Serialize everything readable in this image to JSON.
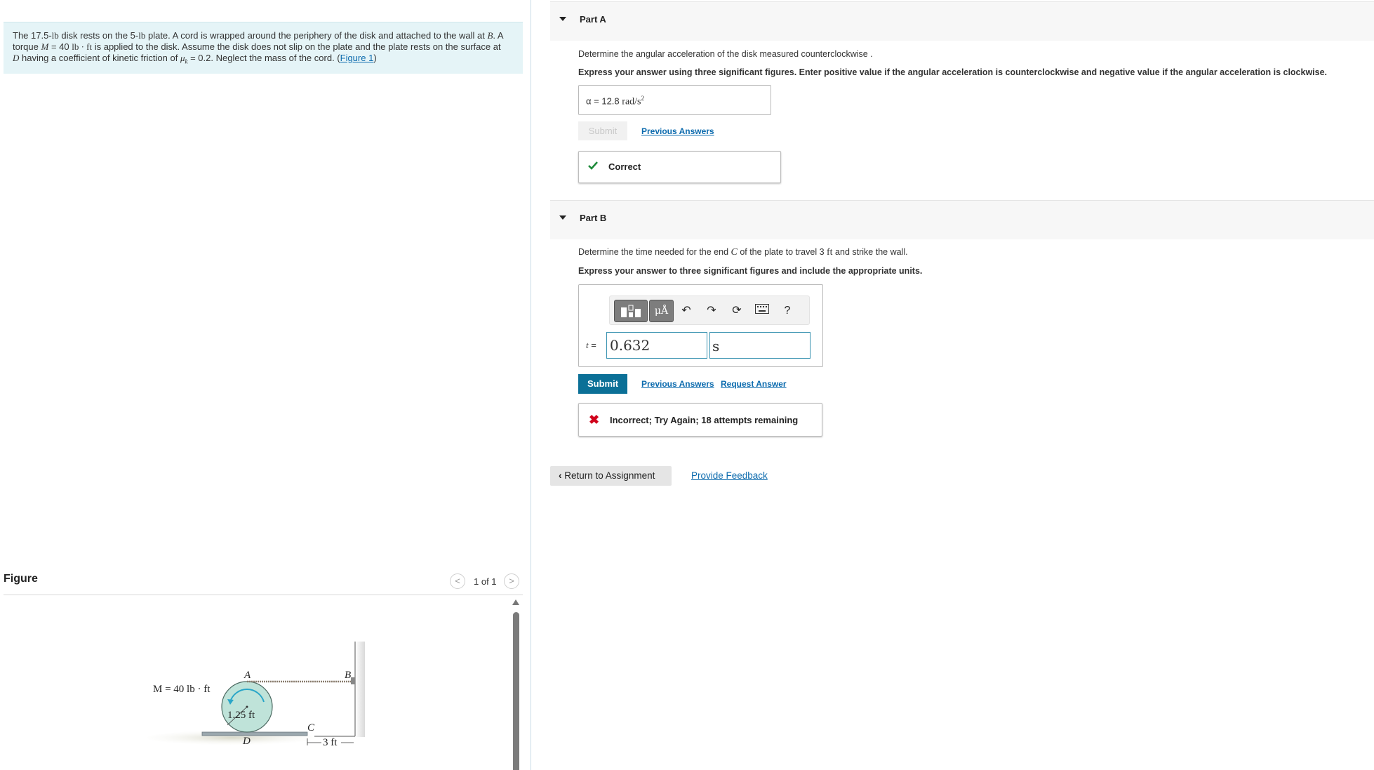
{
  "problem": {
    "text_1": "The 17.5-",
    "unit_lb": "lb",
    "text_2": " disk rests on the 5-",
    "text_3": " plate. A cord is wrapped around the periphery of the disk and attached to the wall at ",
    "point_B": "B",
    "text_4": ". A",
    "text_5": "torque ",
    "symbol_M": "M",
    "text_6": " = 40 ",
    "unit_lbft": "lb · ft",
    "text_7": " is applied to the disk. Assume the disk does not slip on the plate and the plate rests on the surface at",
    "point_D": "D",
    "text_8": " having a coefficient of kinetic friction of ",
    "symbol_mu": "μ",
    "mu_sub": "k",
    "text_9": " = 0.2. Neglect the mass of the cord. (",
    "figure_link": "Figure 1",
    "text_10": ")"
  },
  "figure": {
    "title": "Figure",
    "counter": "1 of 1",
    "prev_glyph": "<",
    "next_glyph": ">",
    "label_M": "M = 40 lb · ft",
    "label_A": "A",
    "label_B": "B",
    "label_C": "C",
    "label_D": "D",
    "label_radius": "1.25 ft",
    "label_dist": "3 ft",
    "colors": {
      "disk": "#bfe3d9",
      "plate": "#9aa7ad",
      "arrow": "#2aa6c8"
    }
  },
  "partA": {
    "title": "Part A",
    "question": "Determine the angular acceleration of the disk measured counterclockwise .",
    "instructions": "Express your answer using three significant figures. Enter positive value if the angular acceleration is counterclockwise and negative value if the angular acceleration is clockwise.",
    "answer_symbol": "α = ",
    "answer_value": "12.8",
    "answer_unit": "rad/s",
    "answer_unit_exp": "2",
    "submit_label": "Submit",
    "previous_answers": "Previous Answers",
    "feedback": "Correct"
  },
  "partB": {
    "title": "Part B",
    "question_1": "Determine the time needed for the end ",
    "point_C": "C",
    "question_2": " of the plate to travel 3 ",
    "unit_ft": "ft",
    "question_3": " and strike the wall.",
    "instructions": "Express your answer to three significant figures and include the appropriate units.",
    "toolbar": {
      "units_label": "μÅ",
      "help_label": "?"
    },
    "answer_symbol": "t",
    "answer_eq": " = ",
    "answer_value": "0.632",
    "answer_unit": "s",
    "submit_label": "Submit",
    "previous_answers": "Previous Answers",
    "request_answer": "Request Answer",
    "feedback": "Incorrect; Try Again; 18 attempts remaining"
  },
  "footer": {
    "return_label": "Return to Assignment",
    "provide_feedback": "Provide Feedback"
  },
  "colors": {
    "accent": "#0b7097",
    "link": "#0c6bae",
    "correct": "#1d8a3a",
    "incorrect": "#d0021b",
    "problem_bg": "#e5f4f7"
  }
}
